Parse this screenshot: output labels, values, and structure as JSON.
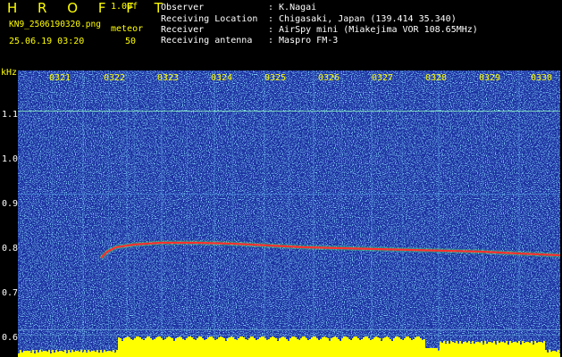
{
  "header": {
    "logo": "H R O F F T",
    "version": "1.00f",
    "filename": "KN9_2506190320.png",
    "mode": "meteor",
    "timestamp": "25.06.19 03:20",
    "gain": "50",
    "info": [
      {
        "label": "Observer",
        "value": ": K.Nagai"
      },
      {
        "label": "Receiving Location",
        "value": ": Chigasaki, Japan (139.414 35.340)"
      },
      {
        "label": "Receiver",
        "value": ": AirSpy mini (Miakejima VOR 108.65MHz)"
      },
      {
        "label": "Receiving antenna",
        "value": ": Maspro FM-3"
      }
    ]
  },
  "plot": {
    "y_unit": "kHz",
    "y_ticks": [
      "1.1",
      "1.0",
      "0.9",
      "0.8",
      "0.7",
      "0.6"
    ],
    "time_labels": [
      "0321",
      "0322",
      "0323",
      "0324",
      "0325",
      "0326",
      "0327",
      "0328",
      "0329",
      "0330"
    ],
    "colors": {
      "background": "#1b2fa0",
      "noise": "#3fb0ff",
      "trace": "#ff3030",
      "level": "#ffff00"
    }
  }
}
